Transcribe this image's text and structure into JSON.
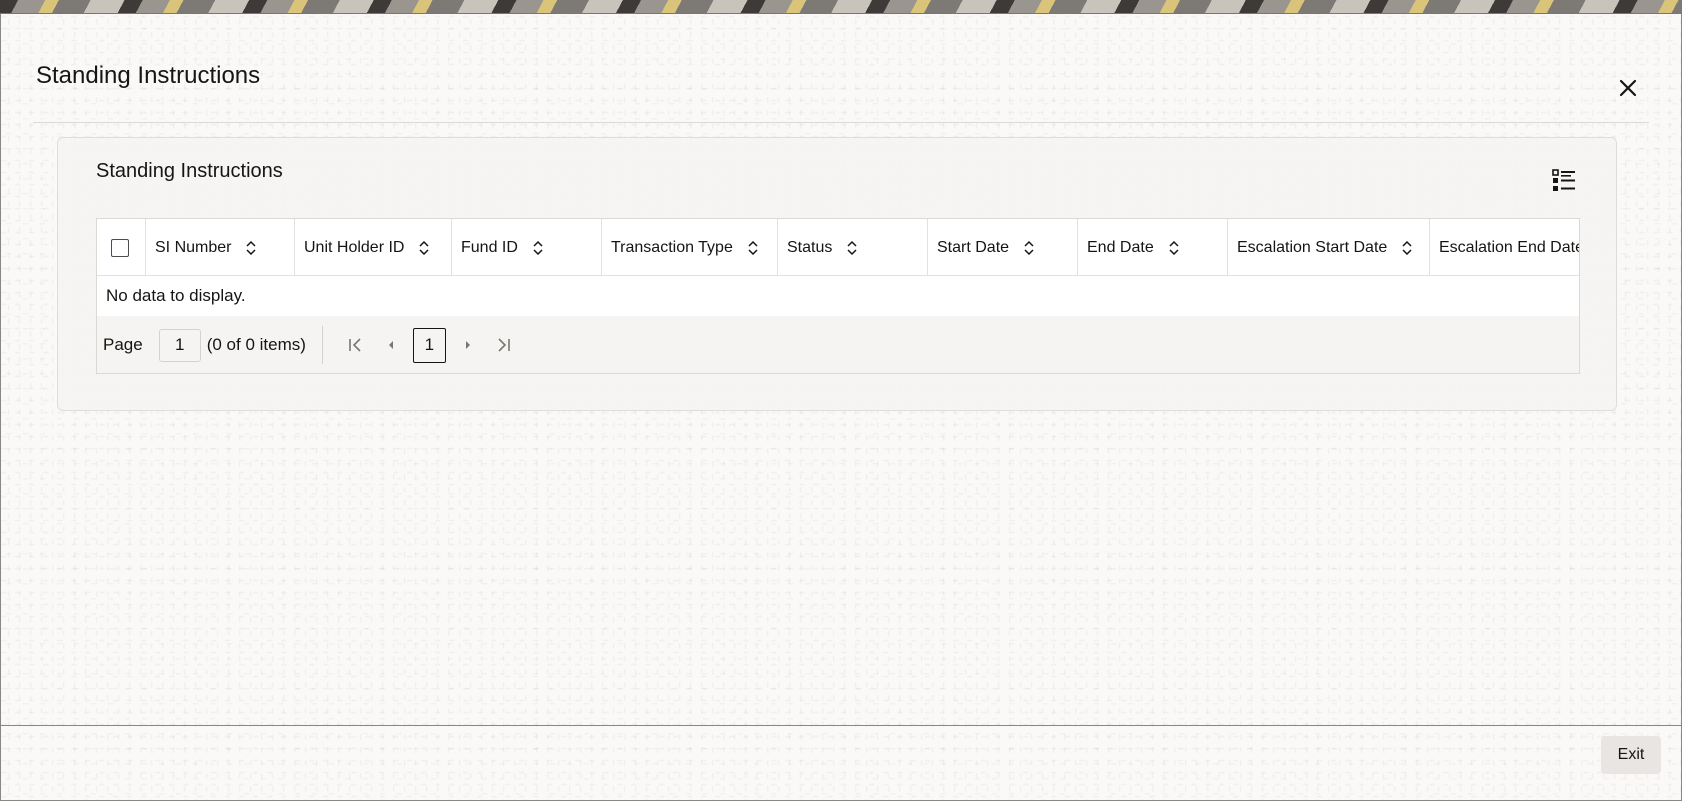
{
  "dialog": {
    "title": "Standing Instructions",
    "close_icon": "close-icon"
  },
  "panel": {
    "title": "Standing Instructions",
    "view_icon": "list-view-icon"
  },
  "table": {
    "columns": [
      {
        "label": "SI Number"
      },
      {
        "label": "Unit Holder ID"
      },
      {
        "label": "Fund ID"
      },
      {
        "label": "Transaction Type"
      },
      {
        "label": "Status"
      },
      {
        "label": "Start Date"
      },
      {
        "label": "End Date"
      },
      {
        "label": "Escalation Start Date"
      },
      {
        "label": "Escalation End Date"
      }
    ],
    "empty_message": "No data to display."
  },
  "pager": {
    "label": "Page",
    "current_page": "1",
    "count_text": "(0 of 0 items)",
    "page_button": "1"
  },
  "footer": {
    "exit_label": "Exit"
  }
}
